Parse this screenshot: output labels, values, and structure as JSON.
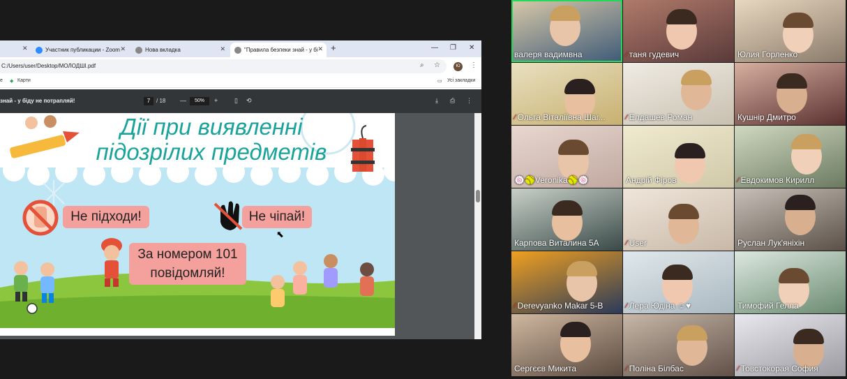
{
  "browser": {
    "tabs": [
      {
        "label": "Участник публикации - Zoom",
        "active": false
      },
      {
        "label": "Нова вкладка",
        "active": false
      },
      {
        "label": "\"Правила безпеки знай - у бі",
        "active": true
      }
    ],
    "new_tab_symbol": "+",
    "url": "C:/Users/user/Desktop/МОЛОДШІ.pdf",
    "avatar_letters": "Ю",
    "bookmarks": {
      "left_item": "Карти",
      "right_item": "Усі закладки"
    }
  },
  "pdf_viewer": {
    "doc_title": "знай - у біду не потрапляй!",
    "current_page": "7",
    "page_total": "/ 18",
    "zoom": "50%",
    "scroll_fraction": 0.36
  },
  "slide": {
    "title_line1": "Дії при виявленні",
    "title_line2": "підозрілих предметів",
    "rule1": "Не підходи!",
    "rule2": "Не чіпай!",
    "rule3_line1": "За номером 101",
    "rule3_line2": "повідомляй!",
    "colors": {
      "title": "#1aa39a",
      "bubble": "#f4a09c",
      "sky": "#bfe6f5",
      "grass": "#8cc63f"
    }
  },
  "participants": [
    {
      "name": "валеря вадимвна",
      "muted": false,
      "active_speaker": true
    },
    {
      "name": "таня гудевич",
      "muted": true
    },
    {
      "name": "Юлия Горленко",
      "muted": false
    },
    {
      "name": "Ольга Віталіївна Шаг...",
      "muted": true
    },
    {
      "name": "Елдашев Роман",
      "muted": true
    },
    {
      "name": "Кушнір Дмитро",
      "muted": false
    },
    {
      "name": "🍥🥎Veronika🥎🍥",
      "muted": false
    },
    {
      "name": "Андрій  Фіров",
      "muted": false
    },
    {
      "name": "Евдокимов Кирилл",
      "muted": true
    },
    {
      "name": "Карпова Виталина 5А",
      "muted": false
    },
    {
      "name": "User",
      "muted": true
    },
    {
      "name": "Руслан Лук'яніхін",
      "muted": false
    },
    {
      "name": "Derevyanko Makar 5-В",
      "muted": true
    },
    {
      "name": "Лера Юдіна ☺♥",
      "muted": true
    },
    {
      "name": "Тимофий Гелла",
      "muted": false
    },
    {
      "name": "Сергєєв Микита",
      "muted": false
    },
    {
      "name": "Поліна Білбас",
      "muted": true
    },
    {
      "name": "Товстокорая София",
      "muted": true
    }
  ]
}
